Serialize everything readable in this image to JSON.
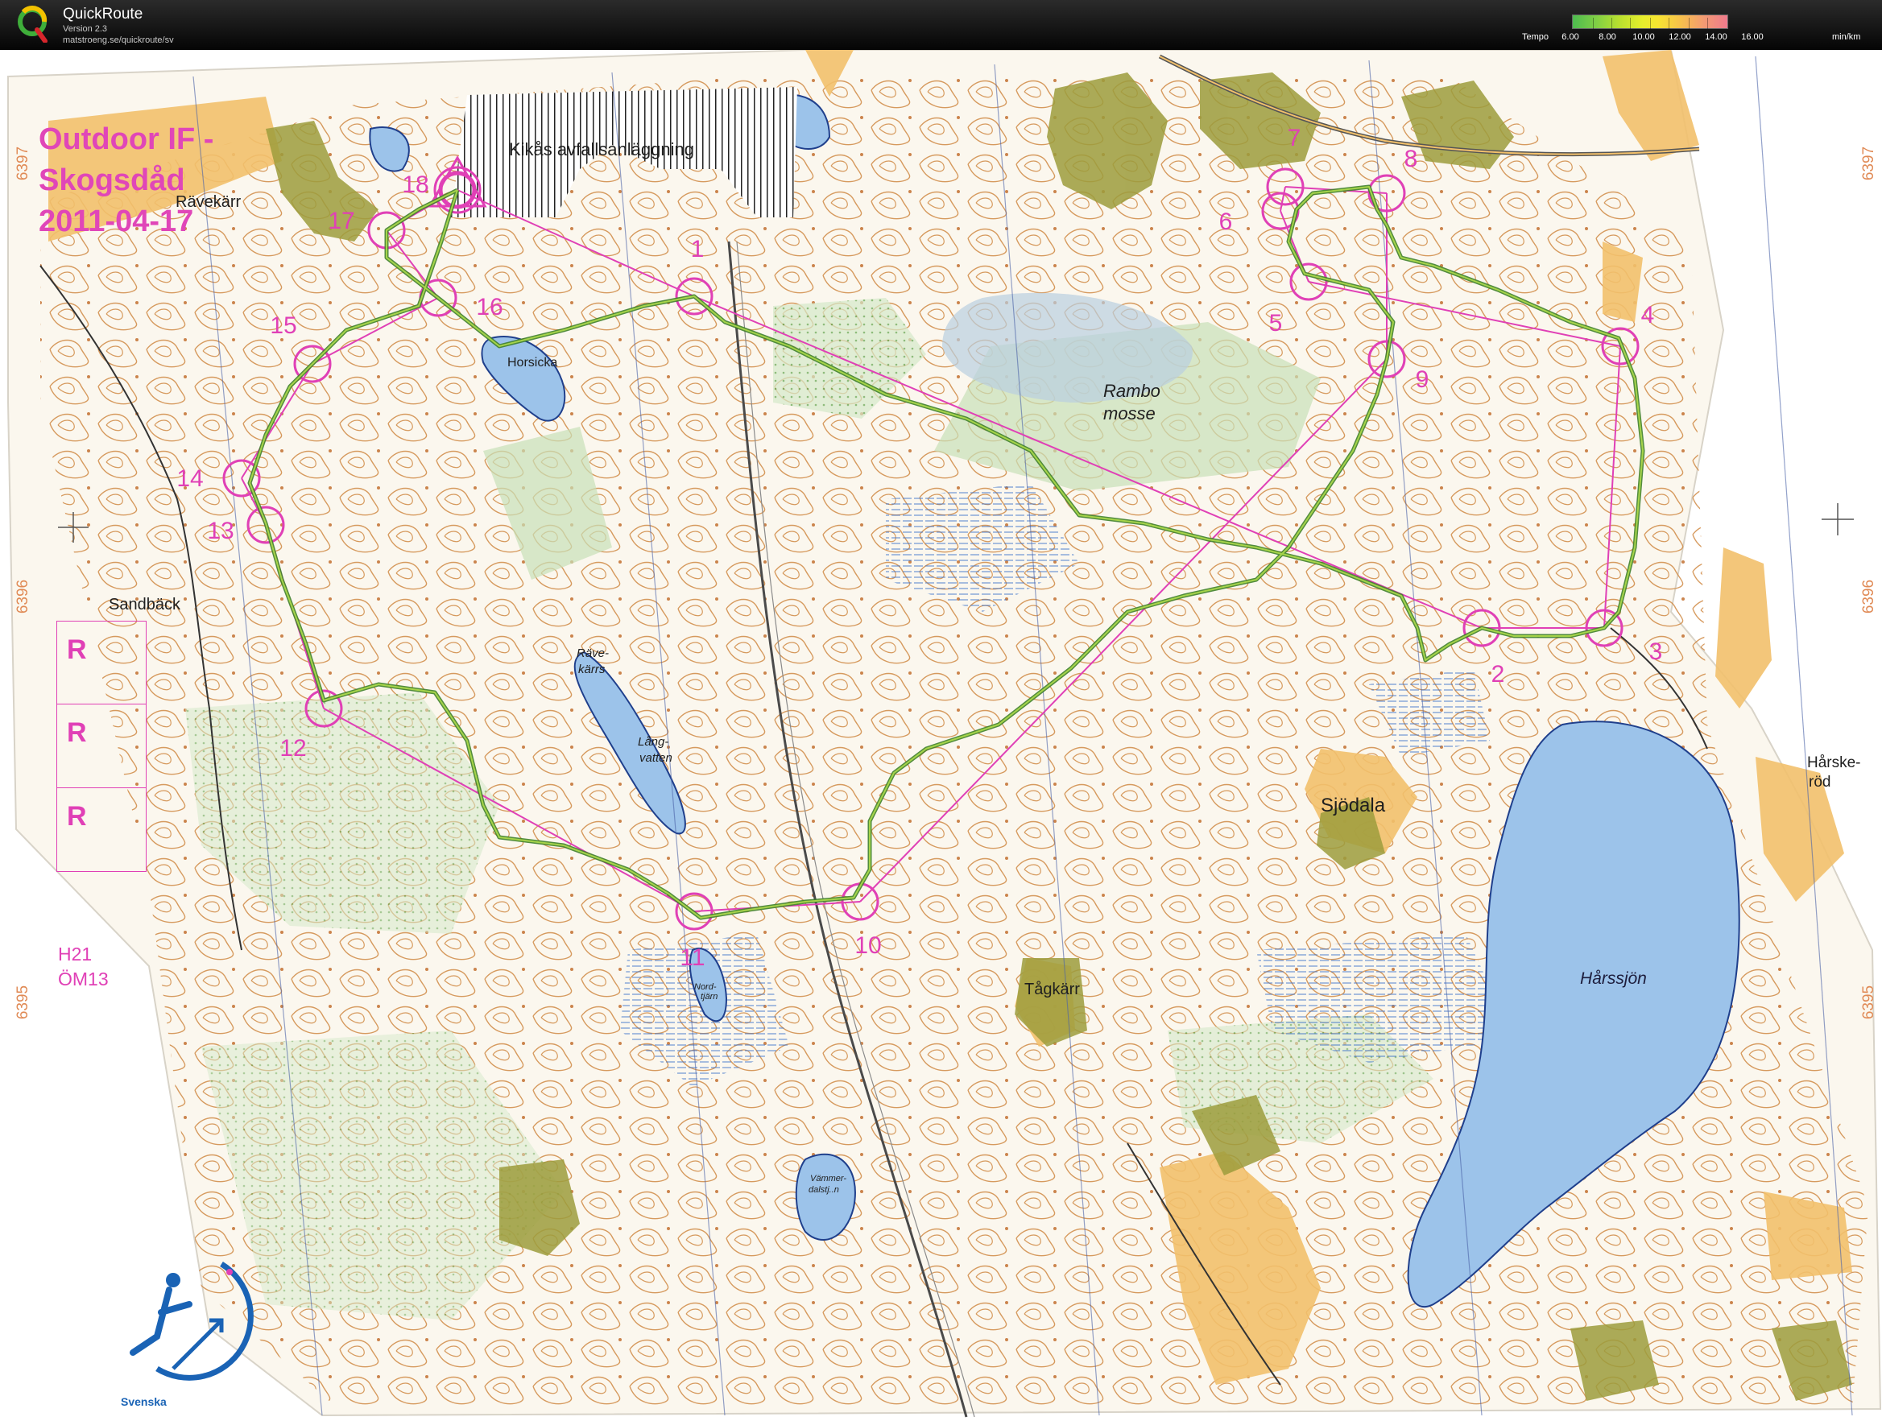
{
  "app": {
    "title": "QuickRoute",
    "version": "Version 2.3",
    "url": "matstroeng.se/quickroute/sv"
  },
  "tempo_legend": {
    "label": "Tempo",
    "ticks": [
      "6.00",
      "8.00",
      "10.00",
      "12.00",
      "14.00",
      "16.00"
    ],
    "unit": "min/km",
    "colors": {
      "fast": "#4dbb4f",
      "mid": "#f7e531",
      "slow": "#ef7a8d"
    }
  },
  "map": {
    "event_title": [
      "Outdoor IF -",
      "Skogsdåd",
      "2011-04-17"
    ],
    "class_lines": [
      "H21",
      "ÖM13"
    ],
    "reserve_boxes": [
      "R",
      "R",
      "R"
    ],
    "place_names": {
      "kikas": "Kikås avfallsanläggning",
      "ravekarr": "Rävekärr",
      "horsicka": "Horsicka",
      "rambo": "Rambo",
      "mosse": "mosse",
      "sandback": "Sandbäck",
      "ravekarrs_1": "Räve-",
      "ravekarrs_2": "kärrs",
      "langvatten_1": "Lång-",
      "langvatten_2": "vatten",
      "sjodala": "Sjödala",
      "harskerod_1": "Hårske-",
      "harskerod_2": "röd",
      "harssjon": "Hårssjön",
      "tagkarr": "Tågkärr",
      "nordtjarn_1": "Nord-",
      "nordtjarn_2": "tjärn",
      "vammerdal_1": "Vämmer-",
      "vammerdal_2": "dalstj..n"
    },
    "grid_numbers": [
      "6397",
      "6396",
      "6395",
      "6397",
      "6396",
      "6395"
    ],
    "controls": [
      {
        "label": "1"
      },
      {
        "label": "2"
      },
      {
        "label": "3"
      },
      {
        "label": "4"
      },
      {
        "label": "5"
      },
      {
        "label": "6"
      },
      {
        "label": "7"
      },
      {
        "label": "8"
      },
      {
        "label": "9"
      },
      {
        "label": "10"
      },
      {
        "label": "11"
      },
      {
        "label": "12"
      },
      {
        "label": "13"
      },
      {
        "label": "14"
      },
      {
        "label": "15"
      },
      {
        "label": "16"
      },
      {
        "label": "17"
      },
      {
        "label": "18"
      }
    ],
    "club_logo_text": "Svenska",
    "colors": {
      "course": "#e040b6",
      "route": "#3f7f2a",
      "water": "#9cc3ea",
      "open_land": "#f4c36c",
      "marsh_green": "#b7d7a8",
      "urban": "#9c9c3c",
      "contour": "#c8823c"
    }
  }
}
